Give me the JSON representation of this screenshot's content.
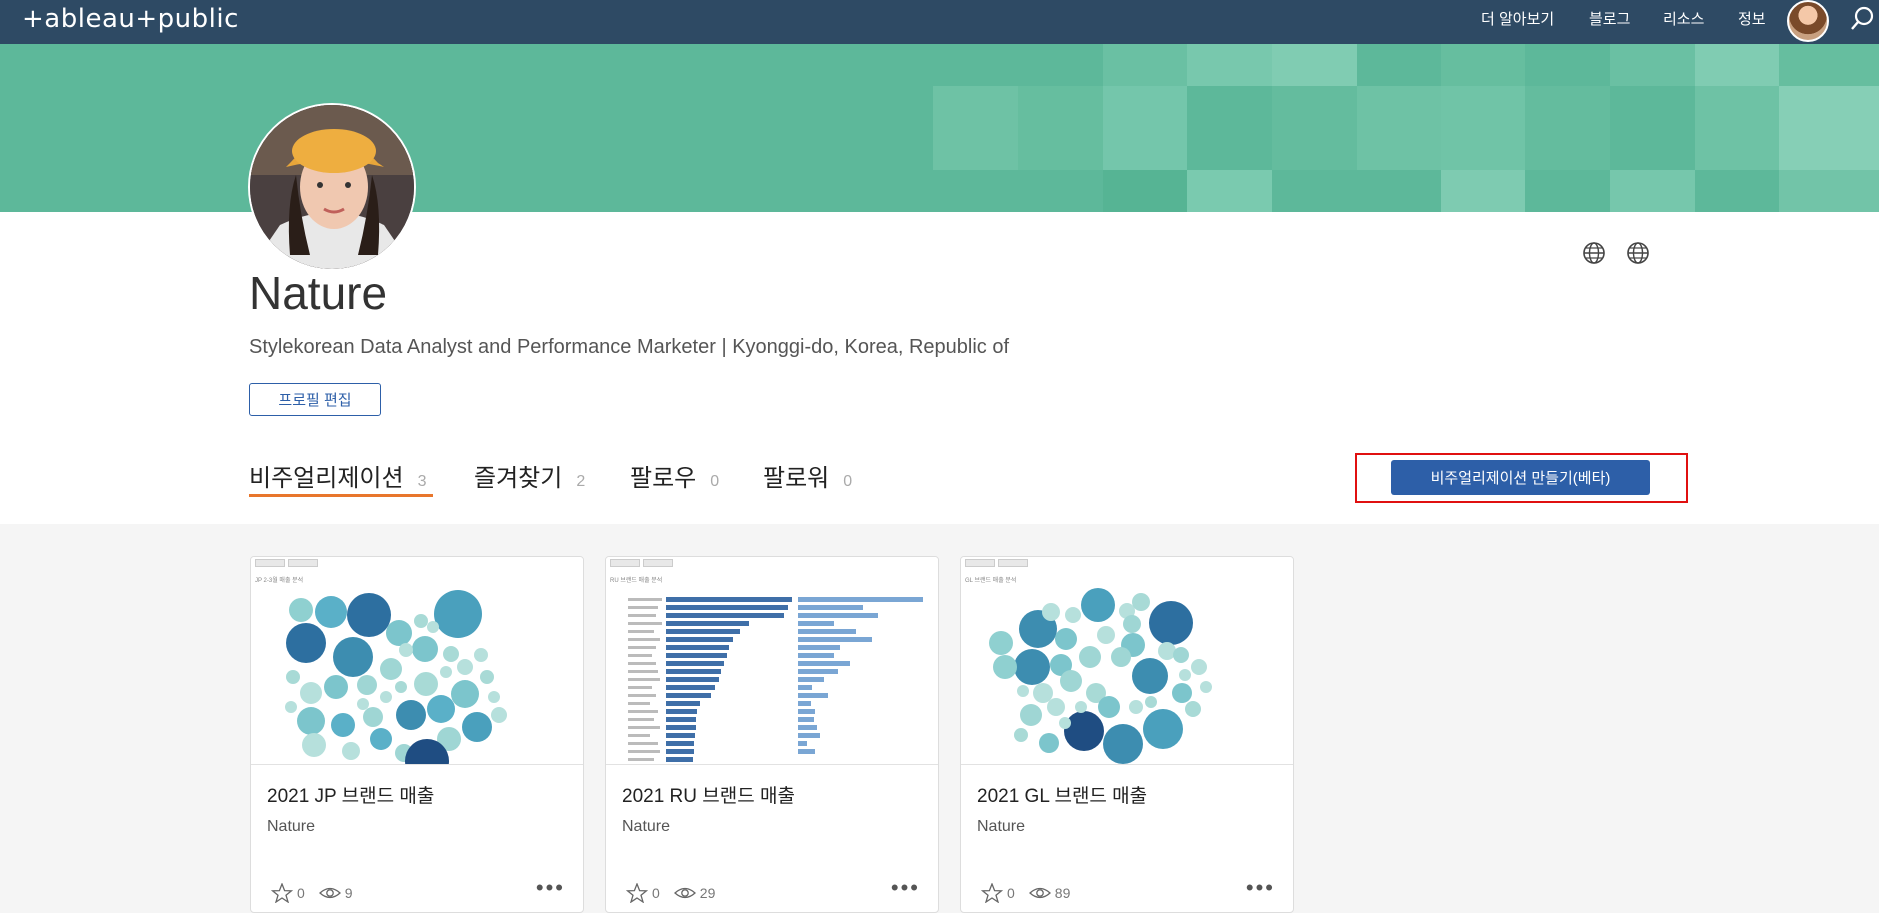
{
  "header": {
    "logo_text": "+ableau+public",
    "nav": [
      "더 알아보기",
      "블로그",
      "리소스",
      "정보"
    ]
  },
  "profile": {
    "name": "Nature",
    "bio": "Stylekorean Data Analyst and Performance Marketer | Kyonggi-do, Korea, Republic of",
    "edit_button": "프로필 편집"
  },
  "tabs": [
    {
      "label": "비주얼리제이션",
      "count": "3"
    },
    {
      "label": "즐겨찾기",
      "count": "2"
    },
    {
      "label": "팔로우",
      "count": "0"
    },
    {
      "label": "팔로워",
      "count": "0"
    }
  ],
  "create_button": "비주얼리제이션 만들기(베타)",
  "cards": [
    {
      "thumb_title": "JP 2-3월 매출 분석",
      "title": "2021 JP 브랜드 매출",
      "author": "Nature",
      "favorites": "0",
      "views": "9"
    },
    {
      "thumb_title": "RU 브랜드 매출 분석",
      "title": "2021 RU 브랜드 매출",
      "author": "Nature",
      "favorites": "0",
      "views": "29"
    },
    {
      "thumb_title": "GL 브랜드 매출 분석",
      "title": "2021 GL 브랜드 매출",
      "author": "Nature",
      "favorites": "0",
      "views": "89"
    }
  ],
  "colors": {
    "topbar": "#2e4a64",
    "banner": "#5db89a",
    "accent_blue": "#2d5fa8",
    "tab_underline": "#e8762c",
    "highlight_border": "#e01010"
  }
}
